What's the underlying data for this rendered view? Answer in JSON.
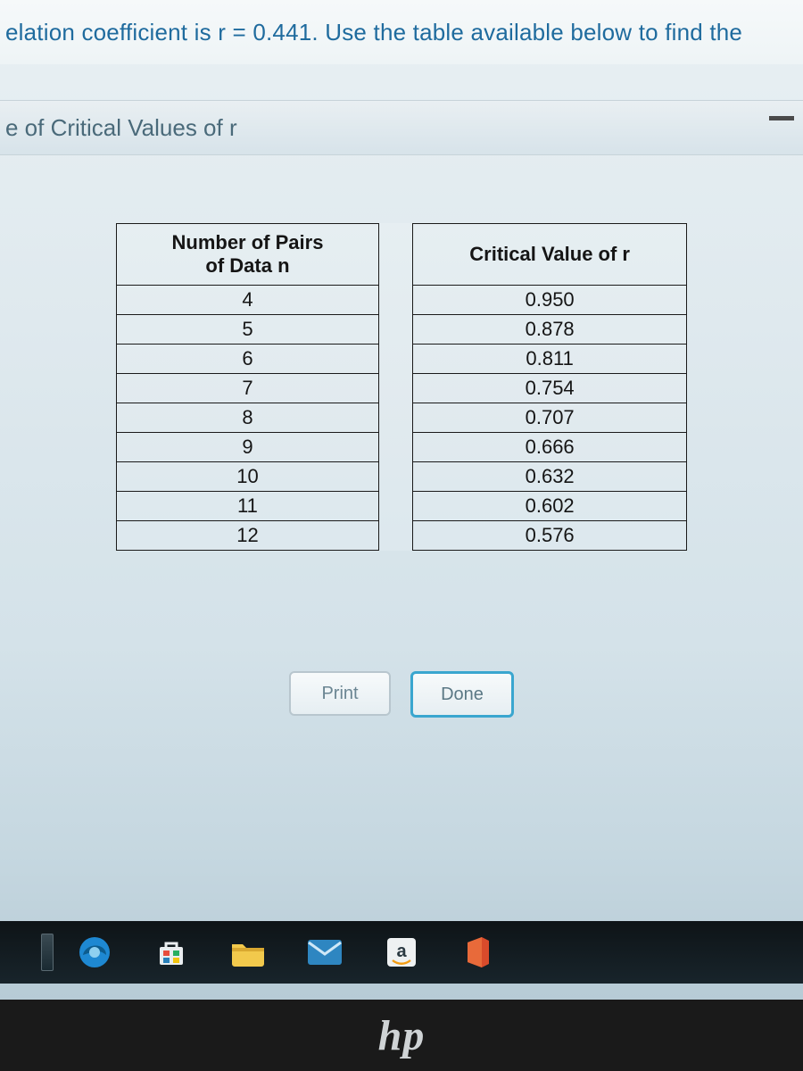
{
  "topbar": {
    "text": "elation coefficient is r = 0.441. Use the table available below to find the"
  },
  "modal": {
    "title": "e of Critical Values of r"
  },
  "table": {
    "head_left_line1": "Number of Pairs",
    "head_left_line2": "of Data n",
    "head_right": "Critical Value of r",
    "rows": [
      {
        "n": "4",
        "cv": "0.950"
      },
      {
        "n": "5",
        "cv": "0.878"
      },
      {
        "n": "6",
        "cv": "0.811"
      },
      {
        "n": "7",
        "cv": "0.754"
      },
      {
        "n": "8",
        "cv": "0.707"
      },
      {
        "n": "9",
        "cv": "0.666"
      },
      {
        "n": "10",
        "cv": "0.632"
      },
      {
        "n": "11",
        "cv": "0.602"
      },
      {
        "n": "12",
        "cv": "0.576"
      }
    ]
  },
  "buttons": {
    "print": "Print",
    "done": "Done"
  },
  "brand": {
    "hp": "hp"
  },
  "chart_data": {
    "type": "table",
    "title": "Critical Values of r",
    "columns": [
      "Number of Pairs of Data n",
      "Critical Value of r"
    ],
    "rows": [
      [
        4,
        0.95
      ],
      [
        5,
        0.878
      ],
      [
        6,
        0.811
      ],
      [
        7,
        0.754
      ],
      [
        8,
        0.707
      ],
      [
        9,
        0.666
      ],
      [
        10,
        0.632
      ],
      [
        11,
        0.602
      ],
      [
        12,
        0.576
      ]
    ]
  }
}
